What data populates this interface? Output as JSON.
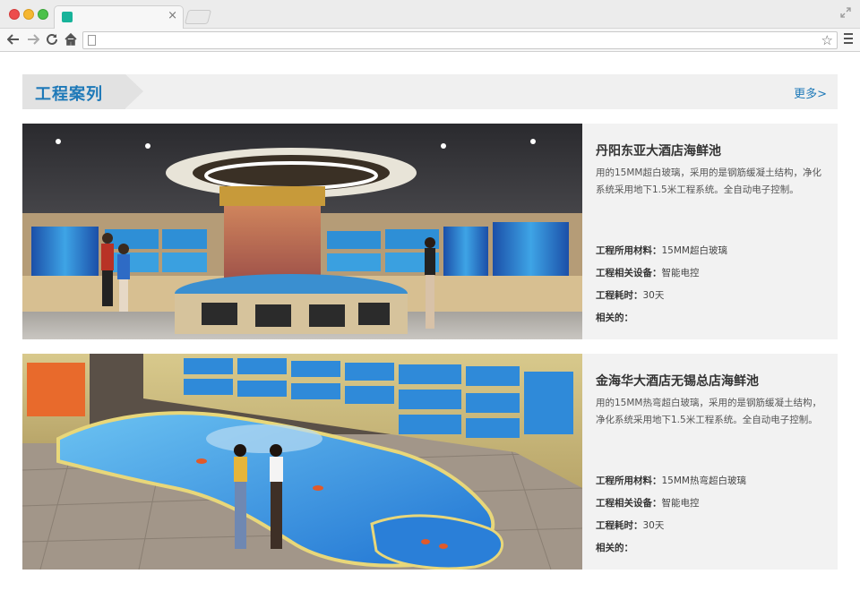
{
  "browser": {
    "tab_close": "×",
    "star": "☆",
    "icons": [
      "back-icon",
      "forward-icon",
      "reload-icon",
      "home-icon",
      "page-icon",
      "star-icon",
      "menu-icon",
      "fullscreen-icon"
    ]
  },
  "section": {
    "title": "工程案列",
    "more": "更多>"
  },
  "cases": [
    {
      "title": "丹阳东亚大酒店海鲜池",
      "description": "用的15MM超白玻璃，采用的是钢筋缓凝土结构，净化系统采用地下1.5米工程系统。全自动电子控制。",
      "material_label": "工程所用材料：",
      "material": "15MM超白玻璃",
      "equipment_label": "工程相关设备：",
      "equipment": "智能电控",
      "duration_label": "工程耗时：",
      "duration": "30天",
      "related_label": "相关的："
    },
    {
      "title": "金海华大酒店无锡总店海鲜池",
      "description": "用的15MM热弯超白玻璃，采用的是钢筋缓凝土结构，净化系统采用地下1.5米工程系统。全自动电子控制。",
      "material_label": "工程所用材料：",
      "material": "15MM热弯超白玻璃",
      "equipment_label": "工程相关设备：",
      "equipment": "智能电控",
      "duration_label": "工程耗时：",
      "duration": "30天",
      "related_label": "相关的："
    }
  ],
  "colors": {
    "accent": "#1e79b8",
    "panel": "#f2f2f2"
  }
}
